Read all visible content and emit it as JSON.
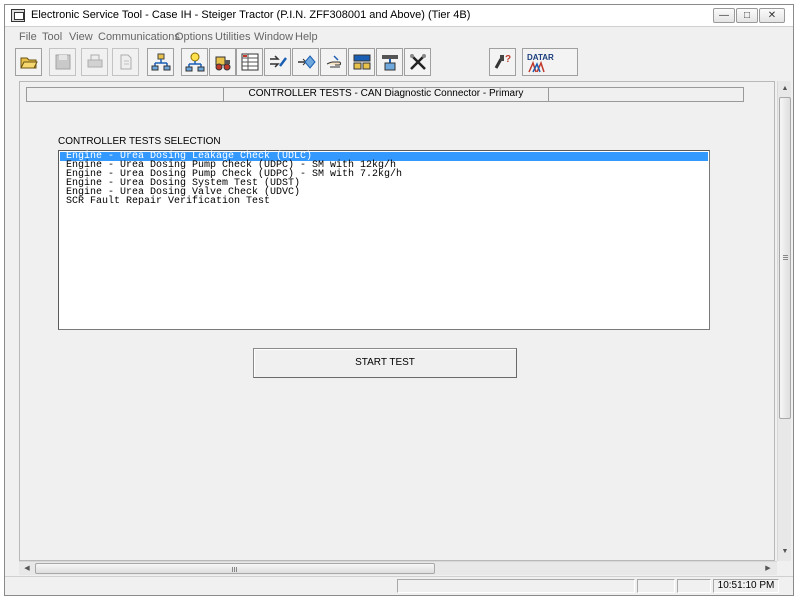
{
  "window": {
    "title": "Electronic Service Tool - Case IH - Steiger Tractor (P.I.N. ZFF308001 and Above) (Tier 4B)",
    "controls": {
      "minimize": "—",
      "restore": "□",
      "close": "✕"
    }
  },
  "menu": [
    "File",
    "Tool",
    "View",
    "Communications",
    "Options",
    "Utilities",
    "Window",
    "Help"
  ],
  "toolbar": {
    "icons": [
      "open-folder-icon",
      "save-disk-icon",
      "print-icon",
      "page-icon",
      "network-icon",
      "network-lightbulb-icon",
      "tractor-tool-icon",
      "ecu-table-icon",
      "arrow-wrench-icon",
      "arrow-diamond-icon",
      "hand-icon",
      "data-grid-icon",
      "flash-program-icon",
      "tools-cross-icon",
      "connector-help-icon",
      "datar-icon"
    ],
    "datar_label": "DATAR"
  },
  "header": {
    "title": "CONTROLLER TESTS  -  CAN Diagnostic Connector - Primary"
  },
  "selection": {
    "label": "CONTROLLER TESTS SELECTION",
    "items": [
      "Engine - Urea Dosing Leakage Check (UDLC)",
      "Engine - Urea Dosing Pump Check (UDPC) - SM with 12kg/h",
      "Engine - Urea Dosing Pump Check (UDPC) - SM with 7.2kg/h",
      "Engine - Urea Dosing System Test (UDST)",
      "Engine - Urea Dosing Valve Check (UDVC)",
      "SCR Fault Repair Verification Test"
    ],
    "selected_index": 0
  },
  "start_button": "START TEST",
  "status": {
    "time": "10:51:10 PM"
  },
  "colors": {
    "selection": "#3399ff",
    "background": "#f0f0f0"
  }
}
